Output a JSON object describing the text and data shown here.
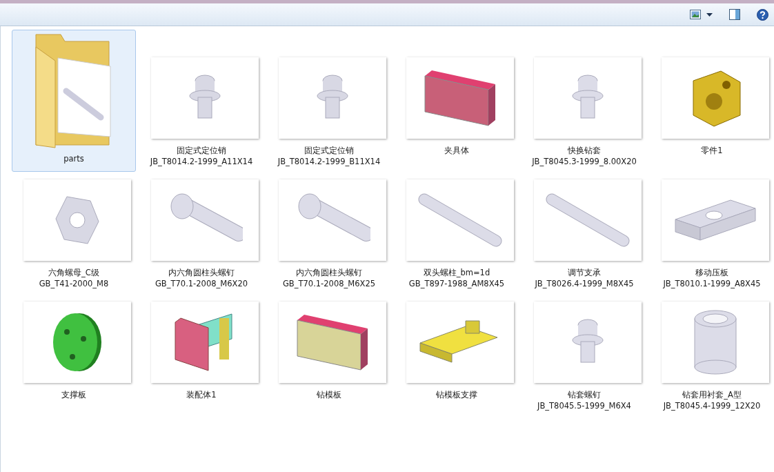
{
  "items": [
    {
      "lines": [
        "parts"
      ],
      "kind": "folder",
      "selected": true
    },
    {
      "lines": [
        "固定式定位销",
        "JB_T8014.2-1999_A11X14"
      ],
      "kind": "pin",
      "color": "#d8d8e4",
      "selected": false
    },
    {
      "lines": [
        "固定式定位销",
        "JB_T8014.2-1999_B11X14"
      ],
      "kind": "pin",
      "color": "#d8d8e4",
      "selected": false
    },
    {
      "lines": [
        "夹具体"
      ],
      "kind": "plate",
      "color": "#c86078",
      "selected": false
    },
    {
      "lines": [
        "快换钻套",
        "JB_T8045.3-1999_8.00X20"
      ],
      "kind": "pin",
      "color": "#dcdce8",
      "selected": false
    },
    {
      "lines": [
        "零件1"
      ],
      "kind": "block",
      "color": "#d8b828",
      "selected": false
    },
    {
      "lines": [
        "六角螺母_C级",
        "GB_T41-2000_M8"
      ],
      "kind": "nut",
      "color": "#d8d8e4",
      "selected": false
    },
    {
      "lines": [
        "内六角圆柱头螺钉",
        "GB_T70.1-2008_M6X20"
      ],
      "kind": "bolt",
      "color": "#dcdce8",
      "selected": false
    },
    {
      "lines": [
        "内六角圆柱头螺钉",
        "GB_T70.1-2008_M6X25"
      ],
      "kind": "bolt",
      "color": "#dcdce8",
      "selected": false
    },
    {
      "lines": [
        "双头螺柱_bm=1d",
        "GB_T897-1988_AM8X45"
      ],
      "kind": "rod",
      "color": "#dcdce8",
      "selected": false
    },
    {
      "lines": [
        "调节支承",
        "JB_T8026.4-1999_M8X45"
      ],
      "kind": "rod",
      "color": "#dcdce8",
      "selected": false
    },
    {
      "lines": [
        "移动压板",
        "JB_T8010.1-1999_A8X45"
      ],
      "kind": "slab",
      "color": "#dcdce8",
      "selected": false
    },
    {
      "lines": [
        "支撑板"
      ],
      "kind": "disk",
      "color": "#40c040",
      "selected": false
    },
    {
      "lines": [
        "装配体1"
      ],
      "kind": "assembly",
      "color": "#d86080",
      "selected": false
    },
    {
      "lines": [
        "钻模板"
      ],
      "kind": "plate",
      "color": "#d8d498",
      "selected": false
    },
    {
      "lines": [
        "钻模板支撑"
      ],
      "kind": "bracket",
      "color": "#f0e040",
      "selected": false
    },
    {
      "lines": [
        "钻套螺钉",
        "JB_T8045.5-1999_M6X4"
      ],
      "kind": "pin",
      "color": "#dcdce8",
      "selected": false
    },
    {
      "lines": [
        "钻套用衬套_A型",
        "JB_T8045.4-1999_12X20"
      ],
      "kind": "bushing",
      "color": "#dcdce8",
      "selected": false
    }
  ]
}
